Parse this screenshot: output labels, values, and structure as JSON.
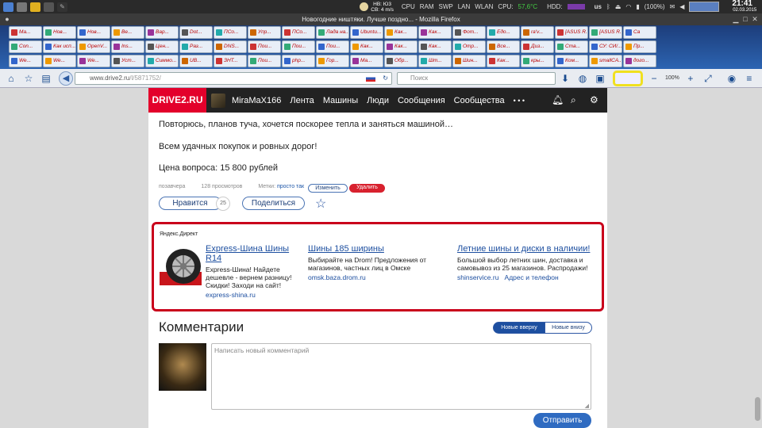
{
  "system_bar": {
    "weather_line1": "НВ: Ю3",
    "weather_line2": "СВ: 4 m/s",
    "cpu": "CPU",
    "ram": "RAM",
    "swp": "SWP",
    "lan": "LAN",
    "wlan": "WLAN",
    "cpu_temp_label": "CPU:",
    "cpu_temp": "57,6°C",
    "hdd_label": "HDD:",
    "layout": "us",
    "battery": "(100%)",
    "time": "21:41",
    "date": "02.03.2015"
  },
  "window": {
    "title": "Новогодние ништяки. Лучше поздно... - Mozilla Firefox"
  },
  "bookmarks": {
    "row1": [
      "Ма...",
      "Нов...",
      "Нов...",
      "Ве...",
      "Вар...",
      "Dot...",
      "ПСо...",
      "Упр...",
      "ПСо...",
      "Лада на...",
      "Ubuntu...",
      "Как...",
      "Как...",
      "Фот...",
      "Едо...",
      "ra'v...",
      "[ASUS R...",
      "[ASUS R...",
      "Ca"
    ],
    "row2": [
      "Con...",
      "Как исп...",
      "OpenV...",
      "Ins...",
      "Цен...",
      "Раз...",
      "DNS...",
      "Пои...",
      "Пои...",
      "Пои...",
      "Как...",
      "Как...",
      "Как...",
      "Отр...",
      "Все...",
      "Диз...",
      "Ста...",
      "СУ: СИ/...",
      "Пр..."
    ],
    "row3": [
      "We...",
      "We...",
      "We...",
      "Уст...",
      "Симмо...",
      "UB...",
      "ЗНТ...",
      "Пои...",
      "php...",
      "Гор...",
      "Ма...",
      "Обр...",
      "Шт...",
      "Шин...",
      "Как...",
      "кры...",
      "Ком...",
      "smallCA...",
      "дого..."
    ]
  },
  "navbar": {
    "url_host": "www.drive2.ru",
    "url_path": "/l/5871752/",
    "search_placeholder": "Поиск",
    "zoom": "100%"
  },
  "site": {
    "logo": "DRIVE2.RU",
    "user": "MiraMaX166",
    "nav": [
      "Лента",
      "Машины",
      "Люди",
      "Сообщения",
      "Сообщества"
    ],
    "more": "• • •"
  },
  "article": {
    "p1": "Повторюсь, планов туча, хочется поскорее тепла и заняться машиной…",
    "p2": "Всем удачных покупок и ровных дорог!",
    "p3": "Цена вопроса: 15 800 рублей"
  },
  "meta": {
    "date": "позавчера",
    "views": "128 просмотров",
    "tags_label": "Метки:",
    "tag": "просто так",
    "edit": "Изменить",
    "delete": "Удалить"
  },
  "actions": {
    "like": "Нравится",
    "like_count": "25",
    "share": "Поделиться"
  },
  "ad": {
    "label": "Яндекс.Директ",
    "items": [
      {
        "title": "Express-Шина Шины R14",
        "text": "Express-Шина! Найдете дешевле - вернем разницу! Скидки! Заходи на сайт!",
        "domain": "express-shina.ru",
        "extra": ""
      },
      {
        "title": "Шины 185 ширины",
        "text": "Выбирайте на Drom! Предложения от магазинов, частных лиц в Омске",
        "domain": "omsk.baza.drom.ru",
        "extra": ""
      },
      {
        "title": "Летние шины и диски в наличии!",
        "text": "Большой выбор летних шин, доставка и самовывоз из 25 магазинов. Распродажи!",
        "domain": "shinservice.ru",
        "extra": "Адрес и телефон"
      }
    ]
  },
  "comments": {
    "title": "Комментарии",
    "sort_new_top": "Новые вверху",
    "sort_new_bottom": "Новые внизу",
    "placeholder": "Написать новый комментарий",
    "send": "Отправить"
  }
}
